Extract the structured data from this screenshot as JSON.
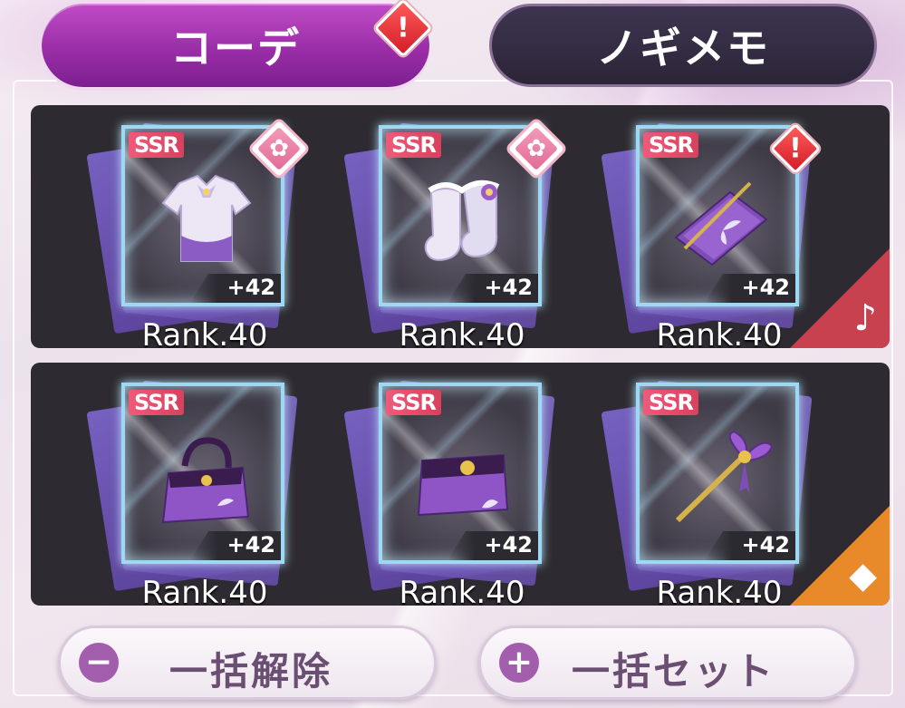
{
  "tabs": [
    {
      "label": "コーデ",
      "active": true,
      "alert": "!"
    },
    {
      "label": "ノギメモ",
      "active": false
    }
  ],
  "rows": [
    {
      "corner_icon": "♪",
      "items": [
        {
          "rarity": "SSR",
          "plus": "+42",
          "rank": "Rank.40",
          "badge": "flower",
          "badge_glyph": "✿",
          "art": "blouse-icon"
        },
        {
          "rarity": "SSR",
          "plus": "+42",
          "rank": "Rank.40",
          "badge": "flower",
          "badge_glyph": "✿",
          "art": "socks-icon"
        },
        {
          "rarity": "SSR",
          "plus": "+42",
          "rank": "Rank.40",
          "badge": "alert",
          "badge_glyph": "!",
          "art": "notebook-icon"
        }
      ]
    },
    {
      "corner_icon": "◆",
      "items": [
        {
          "rarity": "SSR",
          "plus": "+42",
          "rank": "Rank.40",
          "art": "handbag-icon"
        },
        {
          "rarity": "SSR",
          "plus": "+42",
          "rank": "Rank.40",
          "art": "pouch-icon"
        },
        {
          "rarity": "SSR",
          "plus": "+42",
          "rank": "Rank.40",
          "art": "wand-icon"
        }
      ]
    }
  ],
  "buttons": {
    "remove_all": {
      "icon": "−",
      "label": "一括解除"
    },
    "set_all": {
      "icon": "+",
      "label": "一括セット"
    }
  },
  "colors": {
    "active_tab": "#9a2ea8",
    "inactive_tab": "#2c2538",
    "music_tag": "#c8414f",
    "diamond_tag": "#e8892a",
    "accent_purple": "#a35dad"
  }
}
